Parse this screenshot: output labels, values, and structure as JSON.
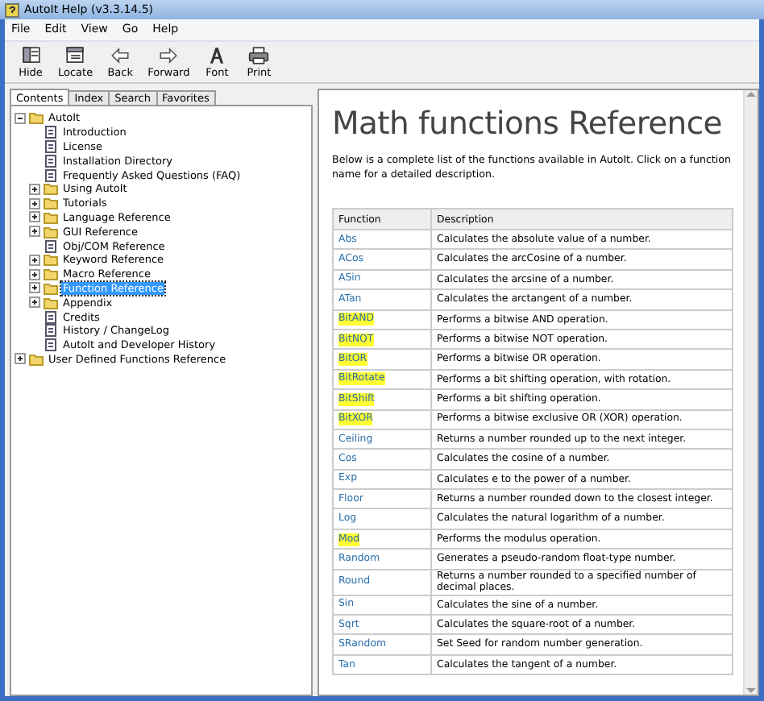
{
  "window": {
    "title": "AutoIt Help (v3.3.14.5)"
  },
  "menu": [
    "File",
    "Edit",
    "View",
    "Go",
    "Help"
  ],
  "toolbar": [
    {
      "label": "Hide"
    },
    {
      "label": "Locate"
    },
    {
      "label": "Back"
    },
    {
      "label": "Forward"
    },
    {
      "label": "Font"
    },
    {
      "label": "Print"
    }
  ],
  "tabs": [
    {
      "label": "Contents",
      "selected": true
    },
    {
      "label": "Index",
      "selected": false
    },
    {
      "label": "Search",
      "selected": false
    },
    {
      "label": "Favorites",
      "selected": false
    }
  ],
  "tree": [
    {
      "label": "AutoIt",
      "kind": "folder",
      "expanded": true,
      "selected": false,
      "children": [
        {
          "label": "Introduction",
          "kind": "page",
          "selected": false
        },
        {
          "label": "License",
          "kind": "page",
          "selected": false
        },
        {
          "label": "Installation Directory",
          "kind": "page",
          "selected": false
        },
        {
          "label": "Frequently Asked Questions (FAQ)",
          "kind": "page",
          "selected": false
        },
        {
          "label": "Using AutoIt",
          "kind": "folder",
          "expanded": false,
          "selected": false
        },
        {
          "label": "Tutorials",
          "kind": "folder",
          "expanded": false,
          "selected": false
        },
        {
          "label": "Language Reference",
          "kind": "folder",
          "expanded": false,
          "selected": false
        },
        {
          "label": "GUI Reference",
          "kind": "folder",
          "expanded": false,
          "selected": false
        },
        {
          "label": "Obj/COM Reference",
          "kind": "page",
          "selected": false
        },
        {
          "label": "Keyword Reference",
          "kind": "folder",
          "expanded": false,
          "selected": false
        },
        {
          "label": "Macro Reference",
          "kind": "folder",
          "expanded": false,
          "selected": false
        },
        {
          "label": "Function Reference",
          "kind": "folder",
          "expanded": false,
          "selected": true
        },
        {
          "label": "Appendix",
          "kind": "folder",
          "expanded": false,
          "selected": false
        },
        {
          "label": "Credits",
          "kind": "page",
          "selected": false
        },
        {
          "label": "History / ChangeLog",
          "kind": "page",
          "selected": false
        },
        {
          "label": "AutoIt and Developer History",
          "kind": "page",
          "selected": false
        }
      ]
    },
    {
      "label": "User Defined Functions Reference",
      "kind": "folder",
      "expanded": false,
      "selected": false
    }
  ],
  "page": {
    "heading": "Math functions Reference",
    "intro": "Below is a complete list of the functions available in AutoIt. Click on a function name for a detailed description.",
    "table": {
      "columns": [
        "Function",
        "Description"
      ],
      "rows": [
        {
          "function": "Abs",
          "description": "Calculates the absolute value of a number.",
          "highlighted": false
        },
        {
          "function": "ACos",
          "description": "Calculates the arcCosine of a number.",
          "highlighted": false
        },
        {
          "function": "ASin",
          "description": "Calculates the arcsine of a number.",
          "highlighted": false
        },
        {
          "function": "ATan",
          "description": "Calculates the arctangent of a number.",
          "highlighted": false
        },
        {
          "function": "BitAND",
          "description": "Performs a bitwise AND operation.",
          "highlighted": true
        },
        {
          "function": "BitNOT",
          "description": "Performs a bitwise NOT operation.",
          "highlighted": true
        },
        {
          "function": "BitOR",
          "description": "Performs a bitwise OR operation.",
          "highlighted": true
        },
        {
          "function": "BitRotate",
          "description": "Performs a bit shifting operation, with rotation.",
          "highlighted": true
        },
        {
          "function": "BitShift",
          "description": "Performs a bit shifting operation.",
          "highlighted": true
        },
        {
          "function": "BitXOR",
          "description": "Performs a bitwise exclusive OR (XOR) operation.",
          "highlighted": true
        },
        {
          "function": "Ceiling",
          "description": "Returns a number rounded up to the next integer.",
          "highlighted": false
        },
        {
          "function": "Cos",
          "description": "Calculates the cosine of a number.",
          "highlighted": false
        },
        {
          "function": "Exp",
          "description": "Calculates e to the power of a number.",
          "highlighted": false
        },
        {
          "function": "Floor",
          "description": "Returns a number rounded down to the closest integer.",
          "highlighted": false
        },
        {
          "function": "Log",
          "description": "Calculates the natural logarithm of a number.",
          "highlighted": false
        },
        {
          "function": "Mod",
          "description": "Performs the modulus operation.",
          "highlighted": true
        },
        {
          "function": "Random",
          "description": "Generates a pseudo-random float-type number.",
          "highlighted": false
        },
        {
          "function": "Round",
          "description": "Returns a number rounded to a specified number of decimal places.",
          "highlighted": false
        },
        {
          "function": "Sin",
          "description": "Calculates the sine of a number.",
          "highlighted": false
        },
        {
          "function": "Sqrt",
          "description": "Calculates the square-root of a number.",
          "highlighted": false
        },
        {
          "function": "SRandom",
          "description": "Set Seed for random number generation.",
          "highlighted": false
        },
        {
          "function": "Tan",
          "description": "Calculates the tangent of a number.",
          "highlighted": false
        }
      ]
    }
  }
}
